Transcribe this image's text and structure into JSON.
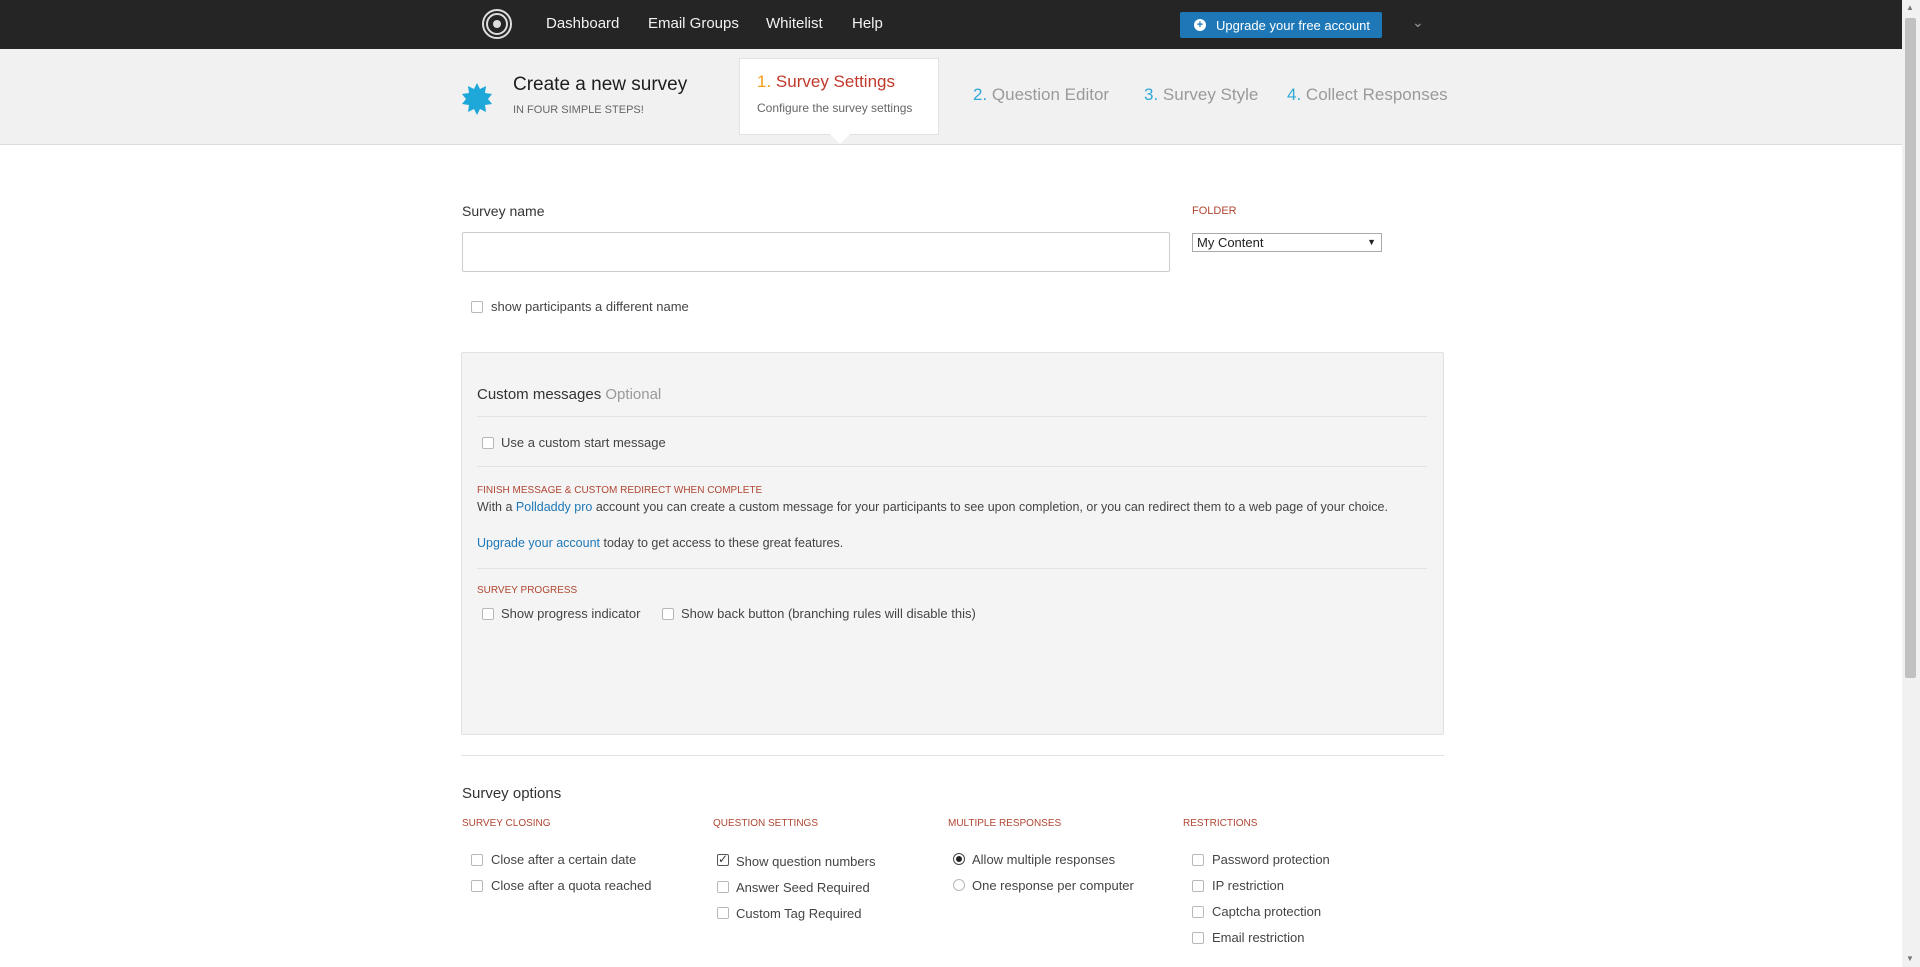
{
  "nav": {
    "links": [
      "Dashboard",
      "Email Groups",
      "Whitelist",
      "Help"
    ],
    "upgrade_label": "Upgrade your free account"
  },
  "header": {
    "title": "Create a new survey",
    "subtitle": "IN FOUR SIMPLE STEPS!",
    "steps": [
      {
        "num": "1.",
        "label": "Survey Settings",
        "sub": "Configure the survey settings"
      },
      {
        "num": "2.",
        "label": "Question Editor"
      },
      {
        "num": "3.",
        "label": "Survey Style"
      },
      {
        "num": "4.",
        "label": "Collect Responses"
      }
    ]
  },
  "form": {
    "name_label": "Survey name",
    "name_value": "",
    "folder_label": "FOLDER",
    "folder_value": "My Content",
    "alt_name_label": "show participants a different name"
  },
  "custom_messages": {
    "title": "Custom messages",
    "optional": "Optional",
    "start_message_label": "Use a custom start message",
    "finish_heading": "FINISH MESSAGE & CUSTOM REDIRECT WHEN COMPLETE",
    "finish_text_before": "With a ",
    "finish_link": "Polldaddy pro",
    "finish_text_after": " account you can create a custom message for your participants to see upon completion, or you can redirect them to a web page of your choice.",
    "upgrade_link": "Upgrade your account",
    "upgrade_text": " today to get access to these great features.",
    "progress_heading": "SURVEY PROGRESS",
    "progress_label": "Show progress indicator",
    "back_label": "Show back button (branching rules will disable this)"
  },
  "options": {
    "title": "Survey options",
    "closing": {
      "heading": "SURVEY CLOSING",
      "items": [
        "Close after a certain date",
        "Close after a quota reached"
      ]
    },
    "questions": {
      "heading": "QUESTION SETTINGS",
      "items": [
        "Show question numbers",
        "Answer Seed Required",
        "Custom Tag Required"
      ]
    },
    "responses": {
      "heading": "MULTIPLE RESPONSES",
      "items": [
        "Allow multiple responses",
        "One response per computer"
      ]
    },
    "restrictions": {
      "heading": "RESTRICTIONS",
      "items": [
        "Password protection",
        "IP restriction",
        "Captcha protection",
        "Email restriction"
      ]
    }
  },
  "colors": {
    "accent": "#1e78b8",
    "step_active": "#c0392b",
    "step_num": "#2fa8d8",
    "section_label": "#b04632"
  }
}
